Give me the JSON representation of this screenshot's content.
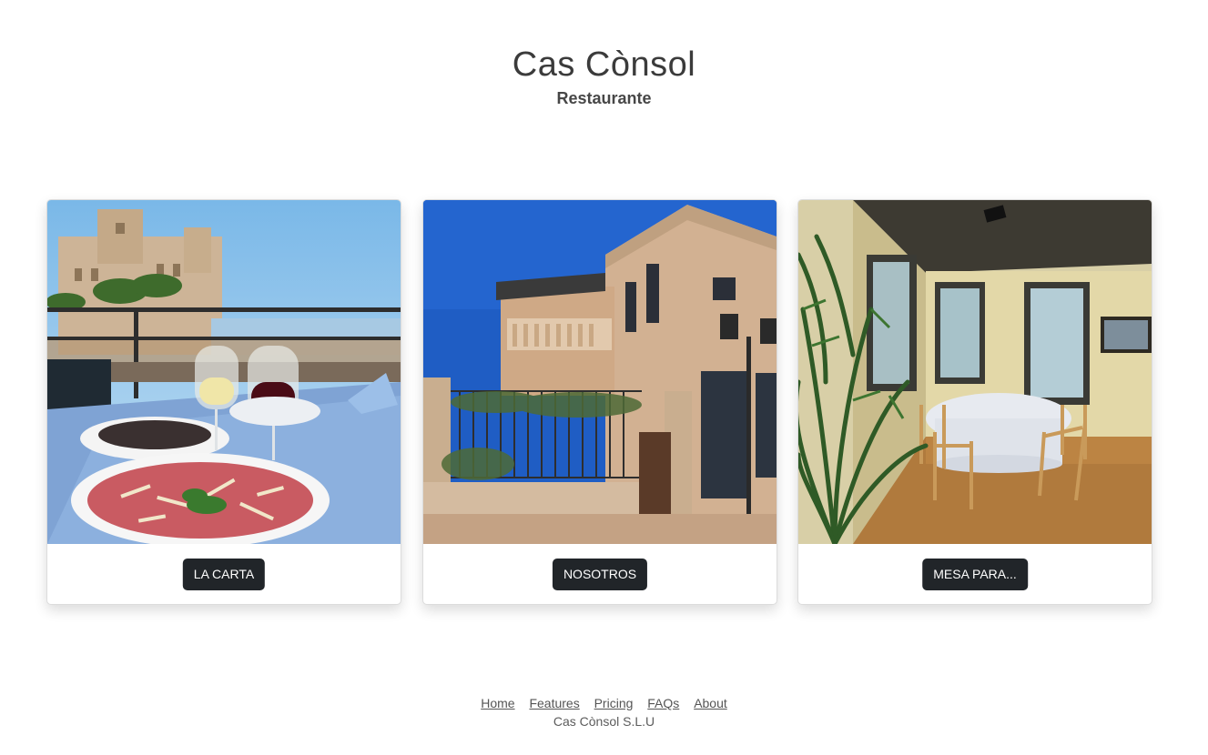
{
  "header": {
    "title": "Cas Cònsol",
    "subtitle": "Restaurante"
  },
  "cards": [
    {
      "image": "restaurant-terrace-table-photo",
      "button_label": "LA CARTA"
    },
    {
      "image": "restaurant-building-facade-photo",
      "button_label": "NOSOTROS"
    },
    {
      "image": "private-dining-room-photo",
      "button_label": "MESA PARA..."
    }
  ],
  "footer": {
    "nav": [
      "Home",
      "Features",
      "Pricing",
      "FAQs",
      "About"
    ],
    "copyright": "Cas Cònsol S.L.U"
  },
  "colors": {
    "button_bg": "#212529",
    "button_text": "#ffffff",
    "title": "#3b3b3b"
  }
}
